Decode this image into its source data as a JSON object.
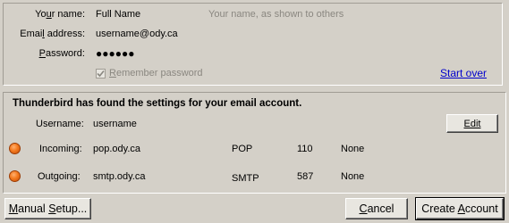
{
  "account": {
    "name_label": "Your name:",
    "name_value": "Full Name",
    "name_hint": "Your name, as shown to others",
    "email_label": "Email address:",
    "email_value": "username@ody.ca",
    "password_label": "Password:",
    "password_value": "●●●●●●",
    "remember_label": "Remember password",
    "remember_checked": true,
    "start_over_label": "Start over"
  },
  "found": {
    "heading": "Thunderbird has found the settings for your email account.",
    "username_label": "Username:",
    "username_value": "username",
    "edit_label": "Edit",
    "servers": [
      {
        "label": "Incoming:",
        "host": "pop.ody.ca",
        "protocol": "POP",
        "port": "110",
        "security": "None",
        "status_color": "#f47a1f"
      },
      {
        "label": "Outgoing:",
        "host": "smtp.ody.ca",
        "protocol": "SMTP",
        "port": "587",
        "security": "None",
        "status_color": "#f47a1f"
      }
    ]
  },
  "buttons": {
    "manual_setup": "Manual Setup...",
    "cancel": "Cancel",
    "create_account": "Create Account"
  }
}
